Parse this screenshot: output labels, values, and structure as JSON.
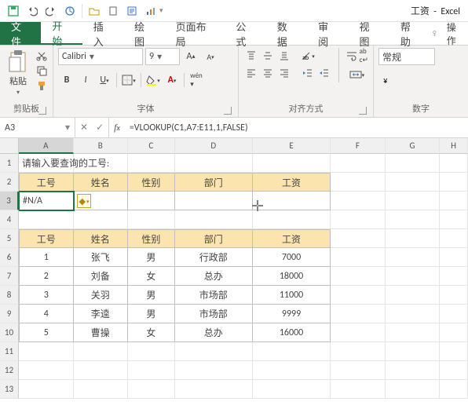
{
  "app": {
    "title": "工资",
    "app_name": "Excel"
  },
  "qat_icons": [
    "save",
    "undo",
    "redo",
    "sync",
    "open",
    "touch",
    "props",
    "chart"
  ],
  "tabs": {
    "file": "文件",
    "items": [
      "开始",
      "插入",
      "绘图",
      "页面布局",
      "公式",
      "数据",
      "审阅",
      "视图",
      "帮助"
    ],
    "active": 0,
    "right": [
      "lightbulb",
      "操作"
    ]
  },
  "ribbon": {
    "clipboard": {
      "paste": "粘贴",
      "label": "剪贴板"
    },
    "font": {
      "name": "Calibri",
      "size": "9",
      "label": "字体"
    },
    "align": {
      "label": "对齐方式"
    },
    "number": {
      "format": "常规",
      "label": "数字"
    }
  },
  "formula_bar": {
    "name_box": "A3",
    "formula": "=VLOOKUP(C1,A7:E11,1,FALSE)"
  },
  "grid": {
    "columns": [
      "A",
      "B",
      "C",
      "D",
      "E",
      "F",
      "G",
      "H"
    ],
    "rows": [
      "1",
      "2",
      "3",
      "4",
      "5",
      "6",
      "7",
      "8",
      "9",
      "10",
      "11",
      "12",
      "13"
    ],
    "selected_col": "A",
    "selected_row": "3",
    "prompt": "请输入要查询的工号:",
    "query_headers": [
      "工号",
      "姓名",
      "性别",
      "部门",
      "工资"
    ],
    "query_result": {
      "a3": "#N/A"
    },
    "table_headers": [
      "工号",
      "姓名",
      "性别",
      "部门",
      "工资"
    ],
    "table_rows": [
      [
        "1",
        "张飞",
        "男",
        "行政部",
        "7000"
      ],
      [
        "2",
        "刘备",
        "女",
        "总办",
        "18000"
      ],
      [
        "3",
        "关羽",
        "男",
        "市场部",
        "11000"
      ],
      [
        "4",
        "李逵",
        "男",
        "市场部",
        "9999"
      ],
      [
        "5",
        "曹操",
        "女",
        "总办",
        "16000"
      ]
    ]
  },
  "chart_data": {
    "type": "table",
    "columns": [
      "工号",
      "姓名",
      "性别",
      "部门",
      "工资"
    ],
    "rows": [
      [
        1,
        "张飞",
        "男",
        "行政部",
        7000
      ],
      [
        2,
        "刘备",
        "女",
        "总办",
        18000
      ],
      [
        3,
        "关羽",
        "男",
        "市场部",
        11000
      ],
      [
        4,
        "李逵",
        "男",
        "市场部",
        9999
      ],
      [
        5,
        "曹操",
        "女",
        "总办",
        16000
      ]
    ]
  }
}
